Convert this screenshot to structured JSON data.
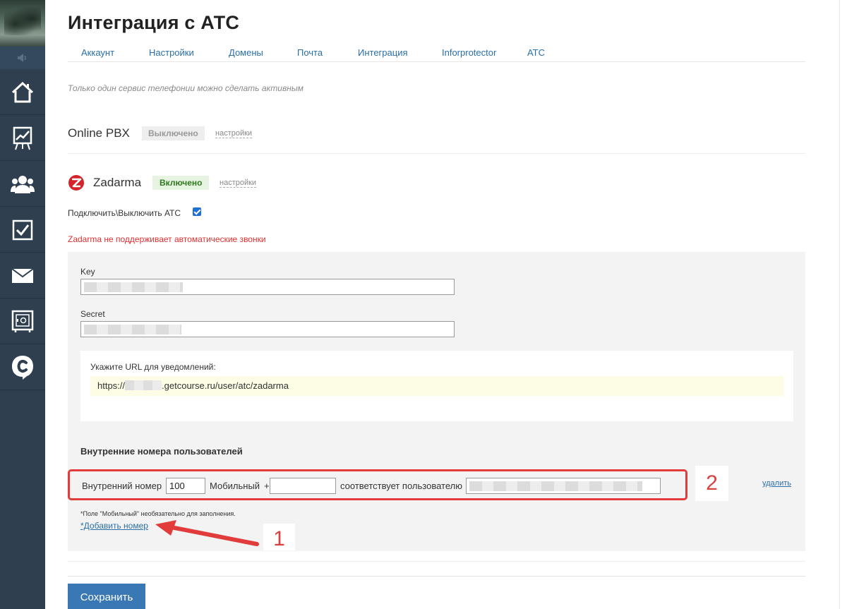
{
  "page": {
    "title": "Интеграция с АТС",
    "notice": "Только один сервис телефонии можно сделать активным"
  },
  "tabs": [
    {
      "label": "Аккаунт"
    },
    {
      "label": "Настройки"
    },
    {
      "label": "Домены"
    },
    {
      "label": "Почта"
    },
    {
      "label": "Интеграция"
    },
    {
      "label": "Inforprotector"
    },
    {
      "label": "АТС"
    }
  ],
  "services": {
    "online_pbx": {
      "name": "Online PBX",
      "status": "Выключено",
      "settings_label": "настройки"
    },
    "zadarma": {
      "name": "Zadarma",
      "status": "Включено",
      "settings_label": "настройки"
    }
  },
  "zadarma": {
    "toggle_label": "Подключить\\Выключить АТС",
    "toggle_checked": true,
    "warning": "Zadarma не поддерживает автоматические звонки",
    "key_label": "Key",
    "secret_label": "Secret",
    "url_label": "Укажите URL для уведомлений:",
    "url_prefix": "https://",
    "url_suffix": ".getcourse.ru/user/atc/zadarma",
    "users_heading": "Внутренние номера пользователей",
    "ext": {
      "ext_label": "Внутренний номер",
      "ext_value": "100",
      "mobile_label": "Мобильный",
      "mobile_prefix": "+",
      "mobile_value": "",
      "user_label": "соответствует пользователю",
      "delete_label": "удалить"
    },
    "hint": "*Поле \"Мобильный\" необязательно для заполнения.",
    "add_label": "*Добавить номер"
  },
  "annotations": {
    "callout_1": "1",
    "callout_2": "2"
  },
  "actions": {
    "save_label": "Сохранить"
  },
  "colors": {
    "accent": "#3a78b5",
    "warning": "#e03030",
    "annotation": "#e23b3b",
    "sidebar": "#2f3f4f"
  },
  "sidebar": {
    "items": [
      {
        "icon": "speaker-icon"
      },
      {
        "icon": "home-icon"
      },
      {
        "icon": "chart-icon"
      },
      {
        "icon": "users-icon"
      },
      {
        "icon": "tasks-icon"
      },
      {
        "icon": "mail-icon"
      },
      {
        "icon": "safe-icon"
      },
      {
        "icon": "chat-logo-icon"
      }
    ]
  }
}
